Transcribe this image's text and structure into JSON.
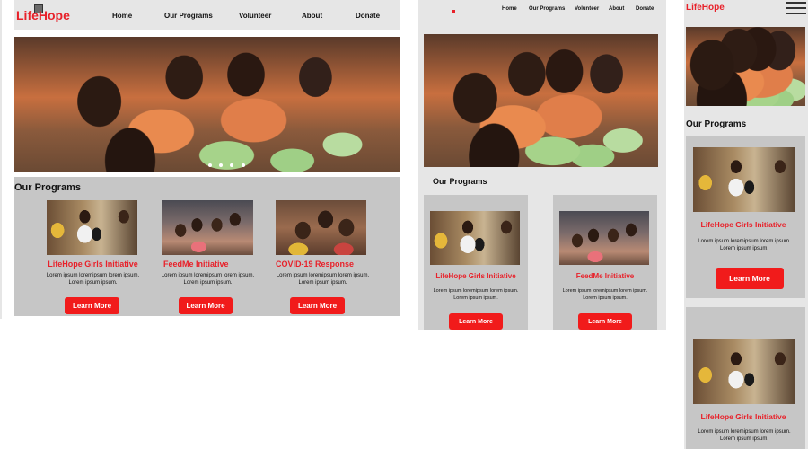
{
  "brand": {
    "name": "LifeHope"
  },
  "nav": [
    "Home",
    "Our Programs",
    "Volunteer",
    "About",
    "Donate"
  ],
  "section_title": "Our Programs",
  "programs": [
    {
      "title": "LifeHope Girls Initiative",
      "text": "Lorem ipsum loremipsum lorem ipsum. Lorem ipsum ipsum.",
      "button": "Learn More"
    },
    {
      "title": "FeedMe Initiative",
      "text": "Lorem ipsum loremipsum lorem ipsum. Lorem ipsum ipsum.",
      "button": "Learn More"
    },
    {
      "title": "COVID-19 Response",
      "text": "Lorem ipsum loremipsum lorem ipsum. Lorem ipsum ipsum.",
      "button": "Learn More"
    }
  ],
  "tablet": {
    "nav": [
      "Home",
      "Our Programs",
      "Volunteer",
      "About",
      "Donate"
    ],
    "section_title": "Our Programs",
    "cards": [
      {
        "title": "LifeHope Girls Initiative",
        "text": "Lorem ipsum loremipsum lorem ipsum. Lorem ipsum ipsum.",
        "button": "Learn More"
      },
      {
        "title": "FeedMe Initiative",
        "text": "Lorem ipsum loremipsum lorem ipsum. Lorem ipsum ipsum.",
        "button": "Learn More"
      }
    ]
  },
  "mobile": {
    "brand": "LifeHope",
    "section_title": "Our Programs",
    "cards": [
      {
        "title": "LifeHope Girls Initiative",
        "text": "Lorem ipsum loremipsum lorem ipsum. Lorem ipsum ipsum.",
        "button": "Learn More"
      },
      {
        "title": "LifeHope Girls Initiative",
        "text": "Lorem ipsum loremipsum lorem ipsum. Lorem ipsum ipsum."
      }
    ]
  },
  "colors": {
    "brand_red": "#e8212a",
    "button_red": "#f11b1b",
    "panel_gray": "#c6c6c6",
    "header_gray": "#e6e6e6"
  },
  "icons": {
    "logo": "logo-square-icon",
    "menu": "hamburger-menu-icon"
  }
}
